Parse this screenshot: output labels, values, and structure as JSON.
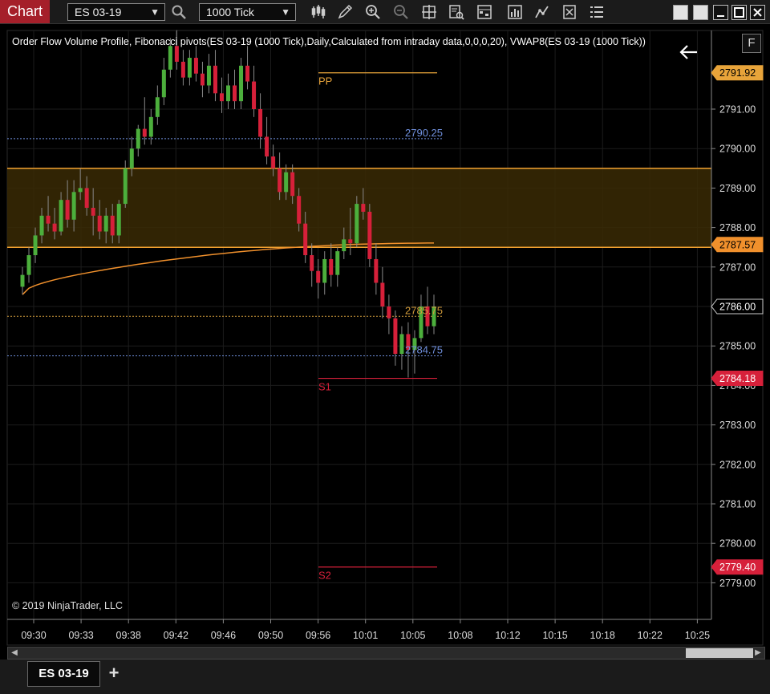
{
  "app": {
    "title": "Chart",
    "instrument": "ES 03-19",
    "interval": "1000 Tick"
  },
  "toolbar": {
    "icons": [
      "bar-type-icon",
      "drawing-tool-icon",
      "zoom-in-icon",
      "zoom-out-icon",
      "crosshair-icon",
      "data-box-icon",
      "properties-icon",
      "indicators-icon",
      "strategies-icon",
      "templates-icon",
      "menu-icon"
    ]
  },
  "chart": {
    "legend": "Order Flow Volume Profile, Fibonacci pivots(ES 03-19 (1000 Tick),Daily,Calculated from intraday data,0,0,0,20), VWAP8(ES 03-19 (1000 Tick))",
    "copyright": "© 2019 NinjaTrader, LLC",
    "f_button": "F",
    "price_axis_ticks": [
      "2791.00",
      "2790.00",
      "2789.00",
      "2788.00",
      "2787.00",
      "2786.00",
      "2785.00",
      "2784.00",
      "2783.00",
      "2782.00",
      "2781.00",
      "2780.00",
      "2779.00"
    ],
    "time_axis_ticks": [
      "09:30",
      "09:33",
      "09:38",
      "09:42",
      "09:46",
      "09:50",
      "09:56",
      "10:01",
      "10:05",
      "10:08",
      "10:12",
      "10:15",
      "10:18",
      "10:22",
      "10:25"
    ],
    "price_markers": [
      {
        "label": "2791.92",
        "price": 2791.92,
        "color": "#e8a43a",
        "text_color": "#000"
      },
      {
        "label": "2787.57",
        "price": 2787.57,
        "color": "#f0902c",
        "text_color": "#000"
      },
      {
        "label": "2786.00",
        "price": 2786.0,
        "color": "#000",
        "text_color": "#fff",
        "border": "#ccc"
      },
      {
        "label": "2784.18",
        "price": 2784.18,
        "color": "#d6203a",
        "text_color": "#fff"
      },
      {
        "label": "2779.40",
        "price": 2779.4,
        "color": "#d6203a",
        "text_color": "#fff"
      }
    ],
    "pivot_labels": [
      {
        "label": "PP",
        "price": 2791.92,
        "color": "#e8a43a"
      },
      {
        "label": "S1",
        "price": 2784.18,
        "color": "#d6203a"
      },
      {
        "label": "S2",
        "price": 2779.4,
        "color": "#d6203a"
      }
    ],
    "level_labels": [
      {
        "label": "2790.25",
        "price": 2790.25,
        "color": "#6f8fdc"
      },
      {
        "label": "2785.75",
        "price": 2785.75,
        "color": "#d09a3a"
      },
      {
        "label": "2784.75",
        "price": 2784.75,
        "color": "#6f8fdc"
      }
    ],
    "value_area": {
      "high": 2789.5,
      "low": 2787.5,
      "fill": "#3a2a05",
      "line": "#f0a030"
    },
    "colors": {
      "up": "#4caf3c",
      "down": "#d6203a",
      "vwap": "#f0902c",
      "grid": "#1c1c1c"
    }
  },
  "chart_data": {
    "type": "candlestick",
    "title": "Order Flow Volume Profile, Fibonacci pivots(ES 03-19 (1000 Tick),Daily,Calculated from intraday data,0,0,0,20), VWAP8(ES 03-19 (1000 Tick))",
    "y_range": [
      2778.5,
      2793.0
    ],
    "candles": [
      [
        2786.5,
        2787.0,
        2786.3,
        2786.8
      ],
      [
        2786.8,
        2787.5,
        2786.6,
        2787.3
      ],
      [
        2787.3,
        2788.0,
        2787.1,
        2787.8
      ],
      [
        2787.8,
        2788.5,
        2787.6,
        2788.3
      ],
      [
        2788.3,
        2788.8,
        2787.9,
        2788.1
      ],
      [
        2788.1,
        2788.5,
        2787.7,
        2787.9
      ],
      [
        2787.9,
        2788.9,
        2787.8,
        2788.7
      ],
      [
        2788.7,
        2789.2,
        2788.0,
        2788.2
      ],
      [
        2788.2,
        2789.2,
        2787.9,
        2788.9
      ],
      [
        2788.9,
        2789.5,
        2788.7,
        2789.0
      ],
      [
        2789.0,
        2789.3,
        2788.3,
        2788.5
      ],
      [
        2788.5,
        2789.0,
        2787.8,
        2788.3
      ],
      [
        2788.3,
        2788.7,
        2787.7,
        2787.9
      ],
      [
        2787.9,
        2788.5,
        2787.6,
        2788.3
      ],
      [
        2788.3,
        2788.6,
        2787.6,
        2787.8
      ],
      [
        2787.8,
        2788.7,
        2787.6,
        2788.6
      ],
      [
        2788.6,
        2789.7,
        2788.5,
        2789.5
      ],
      [
        2789.5,
        2790.3,
        2789.3,
        2790.0
      ],
      [
        2790.0,
        2790.6,
        2789.8,
        2790.5
      ],
      [
        2790.5,
        2791.3,
        2790.1,
        2790.3
      ],
      [
        2790.3,
        2791.0,
        2790.1,
        2790.8
      ],
      [
        2790.8,
        2791.6,
        2790.6,
        2791.3
      ],
      [
        2791.3,
        2792.3,
        2791.1,
        2792.0
      ],
      [
        2792.0,
        2792.8,
        2791.8,
        2792.6
      ],
      [
        2792.6,
        2793.0,
        2792.0,
        2792.2
      ],
      [
        2792.2,
        2792.5,
        2791.6,
        2791.8
      ],
      [
        2791.8,
        2792.5,
        2791.6,
        2792.3
      ],
      [
        2792.3,
        2792.6,
        2791.7,
        2791.9
      ],
      [
        2791.9,
        2792.2,
        2791.3,
        2791.6
      ],
      [
        2791.6,
        2792.4,
        2791.4,
        2792.1
      ],
      [
        2792.1,
        2792.5,
        2791.2,
        2791.4
      ],
      [
        2791.4,
        2791.8,
        2790.9,
        2791.2
      ],
      [
        2791.2,
        2791.9,
        2791.0,
        2791.6
      ],
      [
        2791.6,
        2792.0,
        2791.0,
        2791.2
      ],
      [
        2791.2,
        2792.3,
        2791.0,
        2792.1
      ],
      [
        2792.1,
        2792.6,
        2791.5,
        2791.7
      ],
      [
        2791.7,
        2792.1,
        2790.8,
        2791.0
      ],
      [
        2791.0,
        2791.4,
        2790.0,
        2790.3
      ],
      [
        2790.3,
        2790.8,
        2789.6,
        2789.8
      ],
      [
        2789.8,
        2790.1,
        2789.3,
        2789.5
      ],
      [
        2789.5,
        2789.9,
        2788.7,
        2788.9
      ],
      [
        2788.9,
        2789.6,
        2788.7,
        2789.4
      ],
      [
        2789.4,
        2789.6,
        2788.6,
        2788.8
      ],
      [
        2788.8,
        2789.0,
        2787.9,
        2788.1
      ],
      [
        2788.1,
        2788.4,
        2787.1,
        2787.3
      ],
      [
        2787.3,
        2787.6,
        2786.5,
        2786.9
      ],
      [
        2786.9,
        2787.2,
        2786.2,
        2786.6
      ],
      [
        2786.6,
        2787.4,
        2786.3,
        2787.2
      ],
      [
        2787.2,
        2787.6,
        2786.5,
        2786.8
      ],
      [
        2786.8,
        2787.5,
        2786.5,
        2787.4
      ],
      [
        2787.4,
        2788.0,
        2787.2,
        2787.7
      ],
      [
        2787.7,
        2788.5,
        2787.3,
        2787.6
      ],
      [
        2787.6,
        2788.8,
        2787.5,
        2788.6
      ],
      [
        2788.6,
        2789.0,
        2788.2,
        2788.4
      ],
      [
        2788.4,
        2788.6,
        2787.0,
        2787.2
      ],
      [
        2787.2,
        2787.6,
        2786.3,
        2786.6
      ],
      [
        2786.6,
        2787.0,
        2785.7,
        2786.0
      ],
      [
        2786.0,
        2786.3,
        2785.3,
        2785.7
      ],
      [
        2785.7,
        2785.9,
        2784.5,
        2784.8
      ],
      [
        2784.8,
        2785.5,
        2784.4,
        2785.3
      ],
      [
        2785.3,
        2785.6,
        2784.2,
        2784.9
      ],
      [
        2784.9,
        2785.4,
        2784.3,
        2785.2
      ],
      [
        2785.2,
        2786.3,
        2785.1,
        2786.0
      ],
      [
        2786.0,
        2786.5,
        2785.3,
        2785.5
      ],
      [
        2785.5,
        2786.3,
        2785.3,
        2786.0
      ]
    ],
    "vwap_start": 2786.3,
    "vwap_end": 2787.6
  }
}
